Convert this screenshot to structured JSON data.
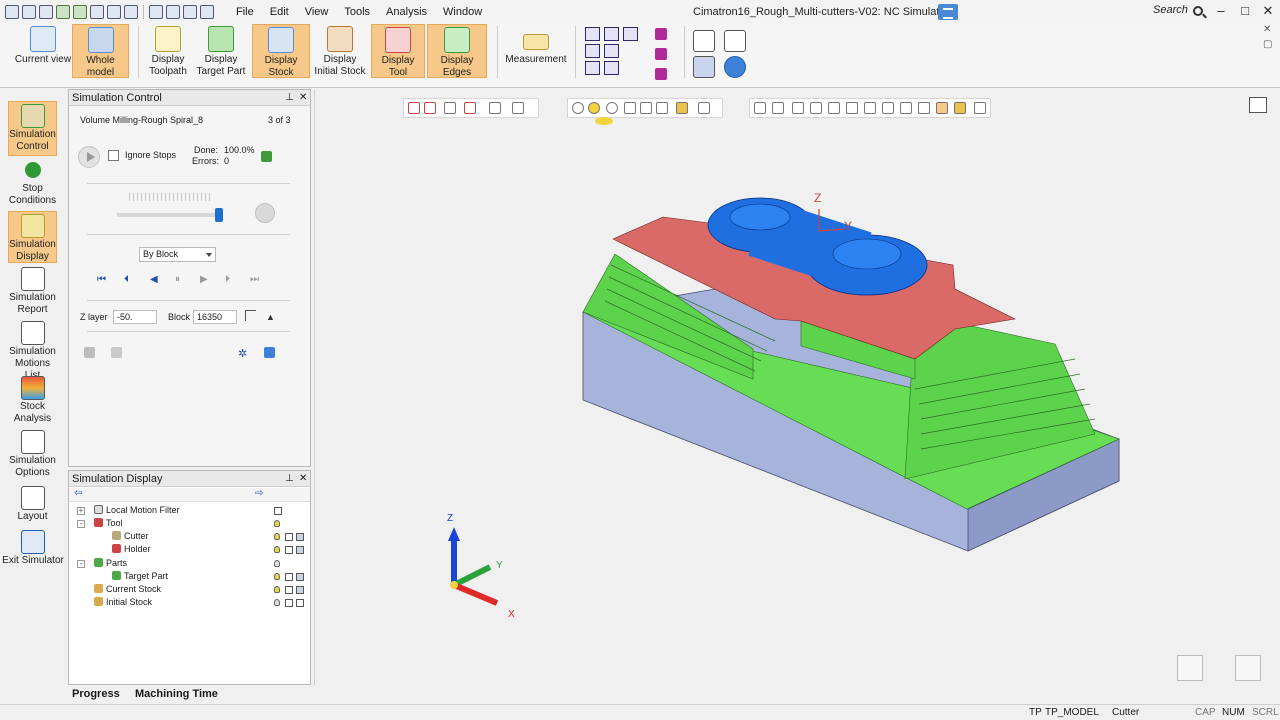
{
  "window": {
    "title": "Cimatron16_Rough_Multi-cutters-V02: NC Simulator",
    "search_placeholder": "Search",
    "minimize": "–",
    "maximize": "□",
    "close": "✕"
  },
  "menu": [
    "File",
    "Edit",
    "View",
    "Tools",
    "Analysis",
    "Window"
  ],
  "ribbon": {
    "buttons": [
      {
        "label": "Current view",
        "active": false,
        "icon": "view-cube-icon",
        "color": "#5b8ed6"
      },
      {
        "label": "Whole model",
        "active": true,
        "icon": "whole-model-icon",
        "color": "#7fa8d8"
      },
      {
        "label": "Display Toolpath",
        "active": false,
        "icon": "toolpath-icon",
        "color": "#e8d54a"
      },
      {
        "label": "Display Target Part",
        "active": false,
        "icon": "target-part-icon",
        "color": "#4caa4a"
      },
      {
        "label": "Display Stock",
        "active": true,
        "icon": "stock-icon",
        "color": "#6c9ad8"
      },
      {
        "label": "Display Initial Stock",
        "active": false,
        "icon": "initial-stock-icon",
        "color": "#d49a54"
      },
      {
        "label": "Display Tool",
        "active": true,
        "icon": "tool-icon",
        "color": "#c44"
      },
      {
        "label": "Display Edges",
        "active": true,
        "icon": "edges-icon",
        "color": "#4caa4a"
      },
      {
        "label": "Measurement",
        "active": false,
        "icon": "ruler-icon",
        "color": "#e8c24a"
      }
    ]
  },
  "left_toolbar": [
    {
      "label": "Simulation Control",
      "active": true,
      "icon": "simulation-control-icon"
    },
    {
      "label": "Stop Conditions",
      "active": false,
      "icon": "stop-conditions-icon"
    },
    {
      "label": "Simulation Display",
      "active": true,
      "icon": "simulation-display-icon"
    },
    {
      "label": "Simulation Report",
      "active": false,
      "icon": "simulation-report-icon"
    },
    {
      "label": "Simulation Motions List",
      "active": false,
      "icon": "motions-list-icon"
    },
    {
      "label": "Stock Analysis",
      "active": false,
      "icon": "stock-analysis-icon"
    },
    {
      "label": "Simulation Options",
      "active": false,
      "icon": "simulation-options-icon"
    },
    {
      "label": "Layout",
      "active": false,
      "icon": "layout-icon"
    },
    {
      "label": "Exit Simulator",
      "active": false,
      "icon": "exit-simulator-icon"
    }
  ],
  "simulation_control": {
    "title": "Simulation Control",
    "procedure": "Volume Milling-Rough Spiral_8",
    "count": "3 of 3",
    "ignore_stops_label": "Ignore Stops",
    "ignore_stops_checked": false,
    "done_label": "Done:",
    "done_value": "100.0%",
    "errors_label": "Errors:",
    "errors_value": "0",
    "speed_fraction": 0.98,
    "mode": "By Block",
    "z_layer_label": "Z layer",
    "z_layer_value": "-50.",
    "block_label": "Block",
    "block_value": "16350"
  },
  "simulation_display": {
    "title": "Simulation Display",
    "tree": [
      {
        "label": "Local Motion Filter",
        "indent": 0,
        "expander": "+",
        "icon": "filter-icon"
      },
      {
        "label": "Tool",
        "indent": 0,
        "expander": "-",
        "icon": "tool-icon"
      },
      {
        "label": "Cutter",
        "indent": 1,
        "expander": "",
        "icon": "cutter-icon"
      },
      {
        "label": "Holder",
        "indent": 1,
        "expander": "",
        "icon": "holder-icon"
      },
      {
        "label": "Parts",
        "indent": 0,
        "expander": "-",
        "icon": "parts-icon"
      },
      {
        "label": "Target Part",
        "indent": 1,
        "expander": "",
        "icon": "target-part-icon"
      },
      {
        "label": "Current Stock",
        "indent": 0,
        "expander": "",
        "icon": "current-stock-icon"
      },
      {
        "label": "Initial Stock",
        "indent": 0,
        "expander": "",
        "icon": "initial-stock-icon"
      }
    ]
  },
  "bottom_tabs": [
    "Progress",
    "Machining Time"
  ],
  "status": {
    "tp": "TP",
    "model": "TP_MODEL",
    "entity": "Cutter",
    "cap": "CAP",
    "num": "NUM",
    "scrl": "SCRL"
  },
  "viewport": {
    "axis_z": "Z",
    "axis_y": "Y",
    "axis_x": "X",
    "colors": {
      "stock_blue": "#a6b4dc",
      "part_green": "#66dd55",
      "cut_red": "#d96a68",
      "tool_blue": "#1f6fe0"
    }
  }
}
